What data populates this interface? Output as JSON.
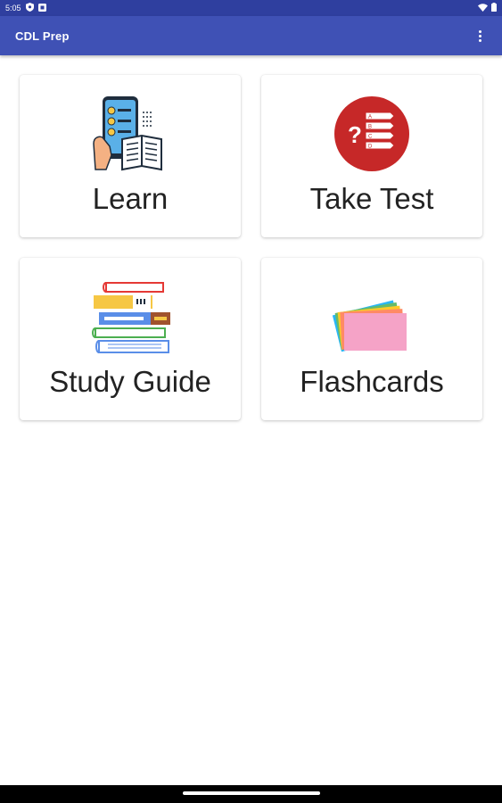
{
  "status_bar": {
    "time": "5:05",
    "icons": [
      "shield-icon",
      "notification-icon",
      "wifi-icon",
      "battery-icon"
    ]
  },
  "app_bar": {
    "title": "CDL Prep",
    "menu_icon": "more-vert-icon"
  },
  "menu": {
    "items": [
      {
        "label": "Learn",
        "icon": "phone-checklist-book-icon"
      },
      {
        "label": "Take Test",
        "icon": "quiz-question-icon"
      },
      {
        "label": "Study Guide",
        "icon": "book-stack-icon"
      },
      {
        "label": "Flashcards",
        "icon": "flashcards-icon"
      }
    ]
  },
  "colors": {
    "status_bar": "#2f3f9f",
    "app_bar": "#3f51b5",
    "quiz_red": "#c62828",
    "flashcard_pink": "#f5a3c7"
  }
}
